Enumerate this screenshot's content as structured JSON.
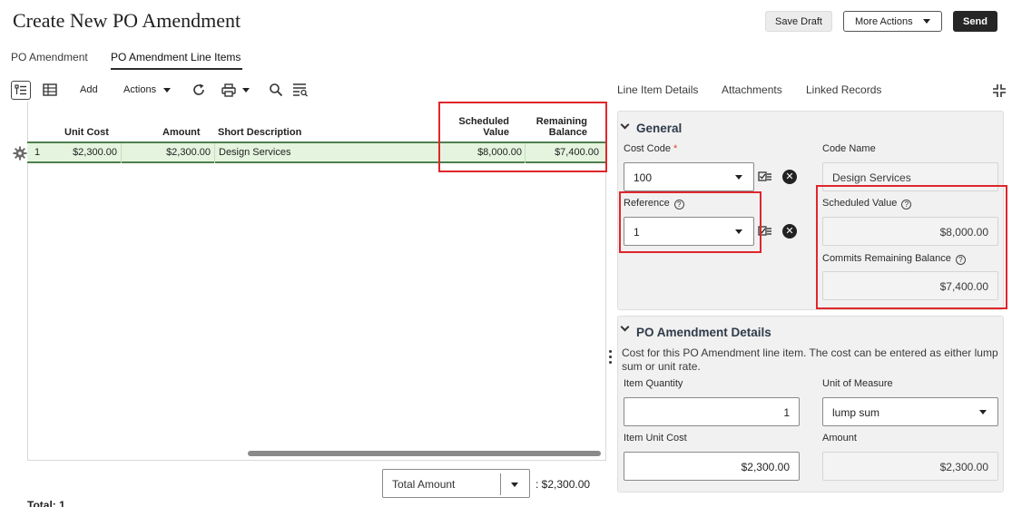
{
  "header": {
    "title": "Create New PO Amendment",
    "save_draft": "Save Draft",
    "more_actions": "More Actions",
    "send": "Send"
  },
  "page_tabs": [
    {
      "label": "PO Amendment",
      "active": false
    },
    {
      "label": "PO Amendment Line Items",
      "active": true
    }
  ],
  "toolbar": {
    "add": "Add",
    "actions": "Actions"
  },
  "grid": {
    "columns": {
      "unit_cost": "Unit Cost",
      "amount": "Amount",
      "short_description": "Short Description",
      "scheduled_value_1": "Scheduled",
      "scheduled_value_2": "Value",
      "remaining_balance_1": "Remaining",
      "remaining_balance_2": "Balance"
    },
    "rows": [
      {
        "num": "1",
        "unit_cost": "$2,300.00",
        "amount": "$2,300.00",
        "short_description": "Design Services",
        "scheduled_value": "$8,000.00",
        "remaining_balance": "$7,400.00"
      }
    ]
  },
  "footer": {
    "total_select": "Total Amount",
    "total_value": ": $2,300.00",
    "total_count": "Total: 1"
  },
  "right_tabs": [
    "Line Item Details",
    "Attachments",
    "Linked Records"
  ],
  "general": {
    "title": "General",
    "cost_code_label": "Cost Code",
    "cost_code_required": "*",
    "cost_code_value": "100",
    "code_name_label": "Code Name",
    "code_name_value": "Design Services",
    "reference_label": "Reference",
    "reference_value": "1",
    "scheduled_value_label": "Scheduled Value",
    "scheduled_value_value": "$8,000.00",
    "commits_remaining_label": "Commits Remaining Balance",
    "commits_remaining_value": "$7,400.00"
  },
  "po_details": {
    "title": "PO Amendment Details",
    "description": "Cost for this PO Amendment line item. The cost can be entered as either lump sum or unit rate.",
    "item_quantity_label": "Item Quantity",
    "item_quantity_value": "1",
    "unit_of_measure_label": "Unit of Measure",
    "unit_of_measure_value": "lump sum",
    "item_unit_cost_label": "Item Unit Cost",
    "item_unit_cost_value": "$2,300.00",
    "amount_label": "Amount",
    "amount_value": "$2,300.00"
  },
  "colors": {
    "highlight_red": "#e0262b",
    "row_selected": "#e4f4de",
    "row_border": "#4f7f4f",
    "send_button": "#262626"
  }
}
